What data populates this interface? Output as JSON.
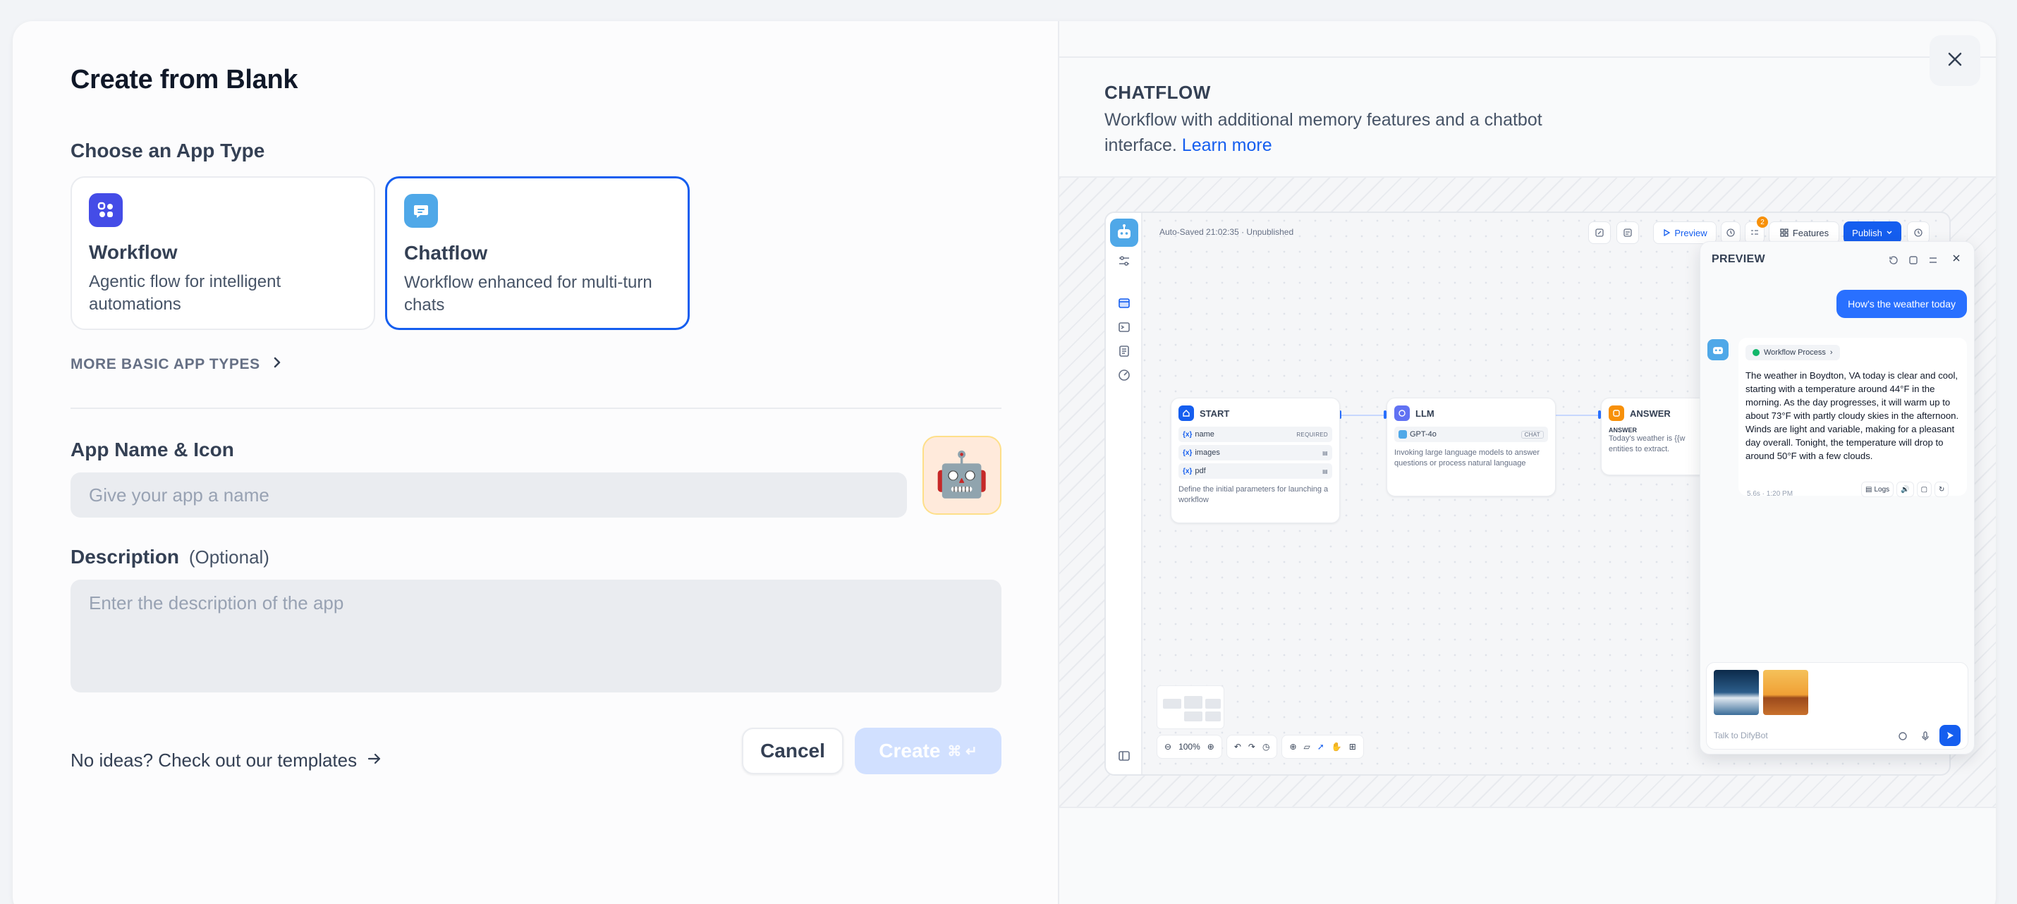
{
  "title": "Create from Blank",
  "app_type_section": {
    "label": "Choose an App Type",
    "cards": [
      {
        "name": "Workflow",
        "description": "Agentic flow for intelligent automations",
        "icon": "workflow-icon",
        "color": "#444ce7"
      },
      {
        "name": "Chatflow",
        "description": "Workflow enhanced for multi-turn chats",
        "icon": "chatflow-icon",
        "color": "#4fa8e8",
        "selected": true
      }
    ],
    "more_types": "MORE BASIC APP TYPES"
  },
  "name_section": {
    "label": "App Name & Icon",
    "placeholder": "Give your app a name",
    "icon_emoji": "🤖"
  },
  "description_section": {
    "label": "Description",
    "optional": "(Optional)",
    "placeholder": "Enter the description of the app"
  },
  "footer": {
    "templates_link": "No ideas? Check out our templates",
    "cancel": "Cancel",
    "create": "Create",
    "create_shortcut": "⌘ ↵"
  },
  "preview": {
    "type_title": "CHATFLOW",
    "description": "Workflow with additional memory features and a chatbot interface.",
    "learn_more": "Learn more",
    "app": {
      "status": "Auto-Saved 21:02:35 · Unpublished",
      "preview_btn": "Preview",
      "features_btn": "Features",
      "publish_btn": "Publish",
      "badge_count": "2",
      "nodes": {
        "start": {
          "title": "START",
          "vars": [
            {
              "name": "name",
              "tag": "REQUIRED"
            },
            {
              "name": "images",
              "tag": ""
            },
            {
              "name": "pdf",
              "tag": ""
            }
          ],
          "var_prefix": "{x}",
          "note": "Define the initial parameters for launching a workflow"
        },
        "llm": {
          "title": "LLM",
          "model": "GPT-4o",
          "mode": "CHAT",
          "note": "Invoking large language models to answer questions or process natural language"
        },
        "answer": {
          "title": "ANSWER",
          "label": "ANSWER",
          "note": "Today's weather is {{w",
          "note2": "entities to extract."
        }
      },
      "zoom": "100%",
      "panel": {
        "title": "PREVIEW",
        "user_message": "How's the weather today",
        "workflow_chip": "Workflow Process",
        "bot_message": "The weather in Boydton, VA today is clear and cool, starting with a temperature around 44°F in the morning. As the day progresses, it will warm up to about 73°F with partly cloudy skies in the afternoon. Winds are light and variable, making for a pleasant day overall. Tonight, the temperature will drop to around 50°F with a few clouds.",
        "meta": "5.6s · 1:20 PM",
        "logs": "Logs",
        "input_placeholder": "Talk to DifyBot"
      }
    }
  },
  "colors": {
    "primary": "#155eef",
    "create_disabled": "#d1e0ff"
  }
}
